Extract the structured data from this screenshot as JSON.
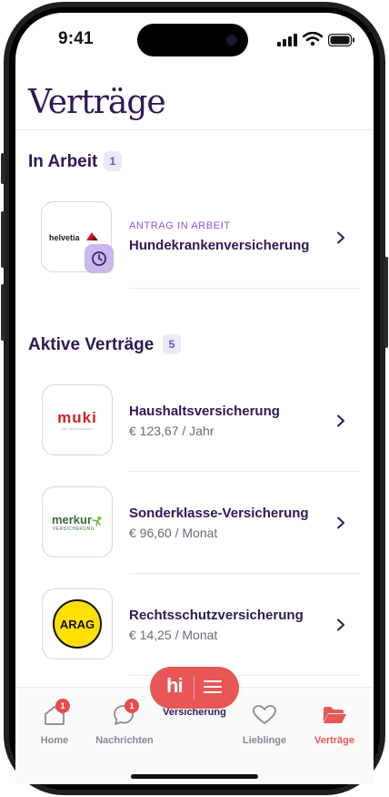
{
  "status_bar": {
    "time": "9:41"
  },
  "page": {
    "title": "Verträge"
  },
  "in_arbeit": {
    "title": "In Arbeit",
    "count": "1",
    "items": [
      {
        "logo": "helvetia",
        "status": "ANTRAG IN ARBEIT",
        "name": "Hundekrankenversicherung"
      }
    ]
  },
  "aktive": {
    "title": "Aktive Verträge",
    "count": "5",
    "items": [
      {
        "logo": "muki",
        "logo_sub": "DIE VERSICHERUNG",
        "name": "Haushaltsversicherung",
        "price": "€ 123,67 / Jahr"
      },
      {
        "logo": "merkur",
        "logo_sub": "VERSICHERUNG",
        "name": "Sonderklasse-Versicherung",
        "price": "€ 96,60 / Monat"
      },
      {
        "logo": "ARAG",
        "name": "Rechtsschutzversicherung",
        "price": "€ 14,25 / Monat"
      }
    ]
  },
  "fab": {
    "label": "hi",
    "partial_label": "Versicherung"
  },
  "nav": {
    "items": [
      {
        "label": "Home",
        "badge": "1",
        "icon": "home-icon",
        "active": false
      },
      {
        "label": "Nachrichten",
        "badge": "1",
        "icon": "chat-icon",
        "active": false
      },
      {
        "label": "Lieblinge",
        "icon": "heart-icon",
        "active": false
      },
      {
        "label": "Verträge",
        "icon": "folder-icon",
        "active": true
      }
    ]
  },
  "colors": {
    "brand_dark": "#2d1a55",
    "accent_purple": "#8a56d6",
    "accent_red": "#e85656"
  }
}
